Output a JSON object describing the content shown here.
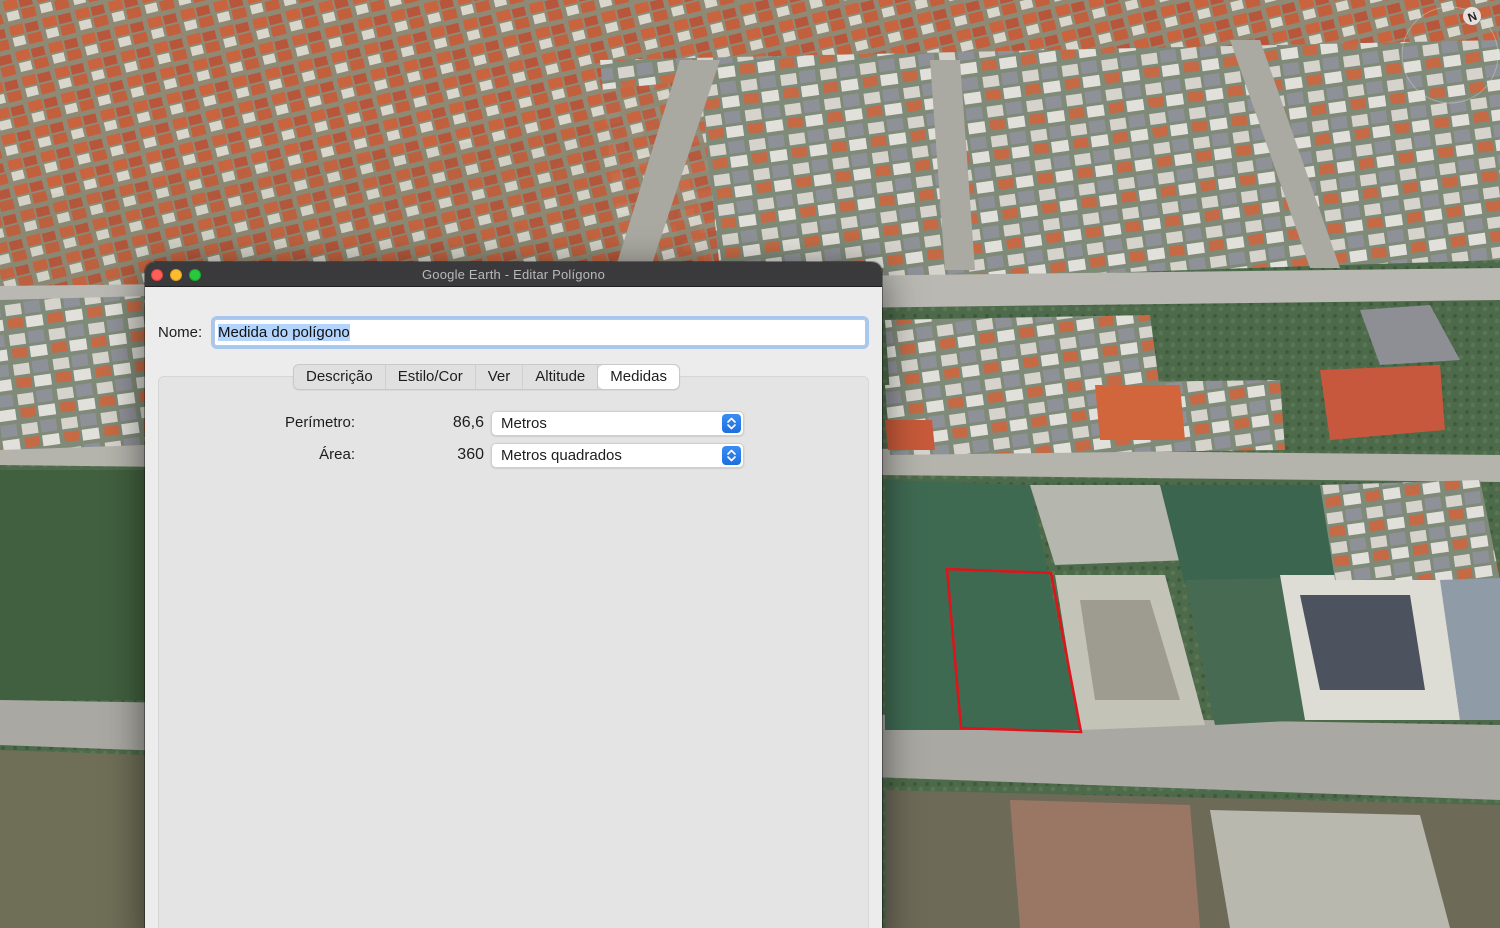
{
  "window": {
    "title": "Google Earth - Editar Polígono"
  },
  "name_field": {
    "label": "Nome:",
    "value": "Medida do polígono"
  },
  "tabs": [
    {
      "label": "Descrição",
      "active": false
    },
    {
      "label": "Estilo/Cor",
      "active": false
    },
    {
      "label": "Ver",
      "active": false
    },
    {
      "label": "Altitude",
      "active": false
    },
    {
      "label": "Medidas",
      "active": true
    }
  ],
  "measurements": {
    "perimeter": {
      "label": "Perímetro:",
      "value": "86,6",
      "unit": "Metros"
    },
    "area": {
      "label": "Área:",
      "value": "360",
      "unit": "Metros quadrados"
    }
  },
  "compass": {
    "label": "N"
  },
  "colors": {
    "polygon_outline": "#e0121a",
    "select_accent": "#1f74e6"
  }
}
